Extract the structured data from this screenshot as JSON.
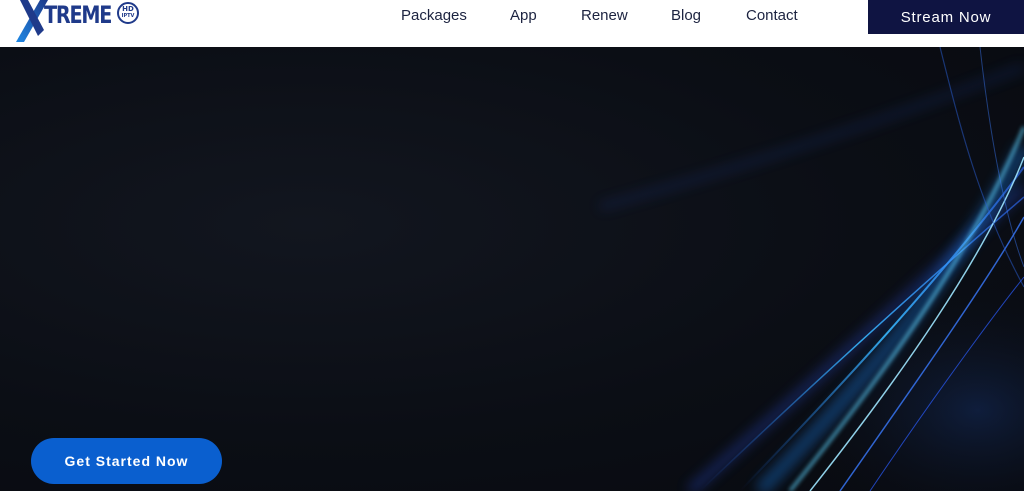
{
  "header": {
    "logo": {
      "main_text": "TREME",
      "badge_top": "HD",
      "badge_bottom": "IPTV",
      "brand_color": "#1f3a8a",
      "accent_color": "#1e88e5"
    },
    "nav": [
      {
        "label": "Packages"
      },
      {
        "label": "App"
      },
      {
        "label": "Renew"
      },
      {
        "label": "Blog"
      },
      {
        "label": "Contact"
      }
    ],
    "stream_button": {
      "label": "Stream Now",
      "color": "#0f1442"
    }
  },
  "hero": {
    "background_color": "#0b0e14",
    "cta": {
      "label": "Get Started Now",
      "color": "#0a5fcf"
    }
  }
}
